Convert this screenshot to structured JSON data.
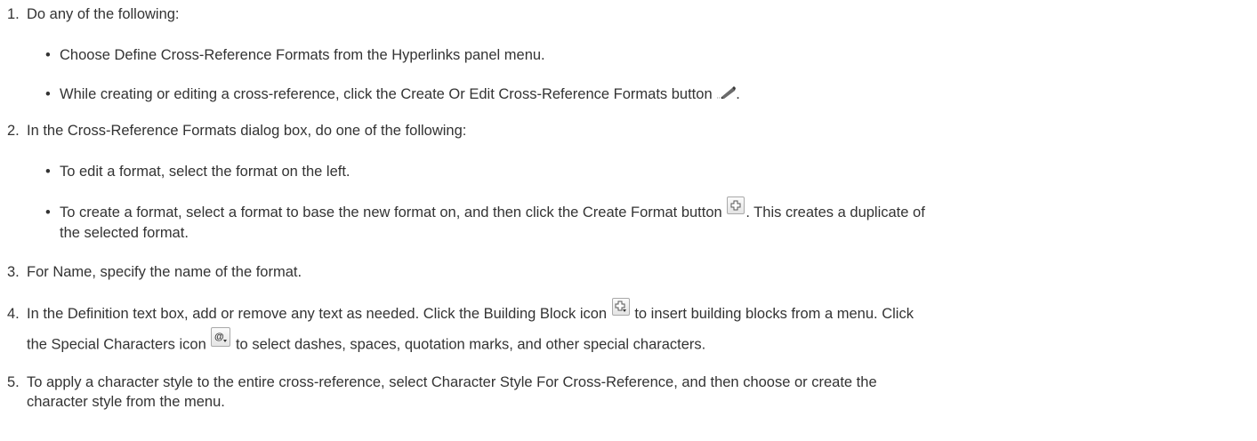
{
  "steps": [
    {
      "number": "1.",
      "text": "Do any of the following:"
    },
    {
      "number": "2.",
      "text": "In the Cross-Reference Formats dialog box, do one of the following:"
    },
    {
      "number": "3.",
      "text": "For Name, specify the name of the format."
    },
    {
      "number": "4.",
      "text_a": "In the Definition text box, add or remove any text as needed. Click the Building Block icon",
      "text_b": "to insert building blocks from a menu. Click",
      "text_c": "the Special Characters icon",
      "text_d": "to select dashes, spaces, quotation marks, and other special characters."
    },
    {
      "number": "5.",
      "text": "To apply a character style to the entire cross-reference, select Character Style For Cross-Reference, and then choose or create the",
      "text_cont": "character style from the menu."
    }
  ],
  "bullets": {
    "step1_a": "Choose Define Cross-Reference Formats from the Hyperlinks panel menu.",
    "step1_b_pre": "While creating or editing a cross-reference, click the Create Or Edit Cross-Reference Formats button",
    "step1_b_post": ".",
    "step2_a": "To edit a format, select the format on the left.",
    "step2_b_pre": "To create a format, select a format to base the new format on, and then click the Create Format button",
    "step2_b_post": ". This creates a duplicate of",
    "step2_b_cont": "the selected format."
  },
  "bullet_glyph": "•",
  "icons": [
    "pencil-icon",
    "create-format-icon",
    "building-block-icon",
    "special-characters-icon"
  ]
}
